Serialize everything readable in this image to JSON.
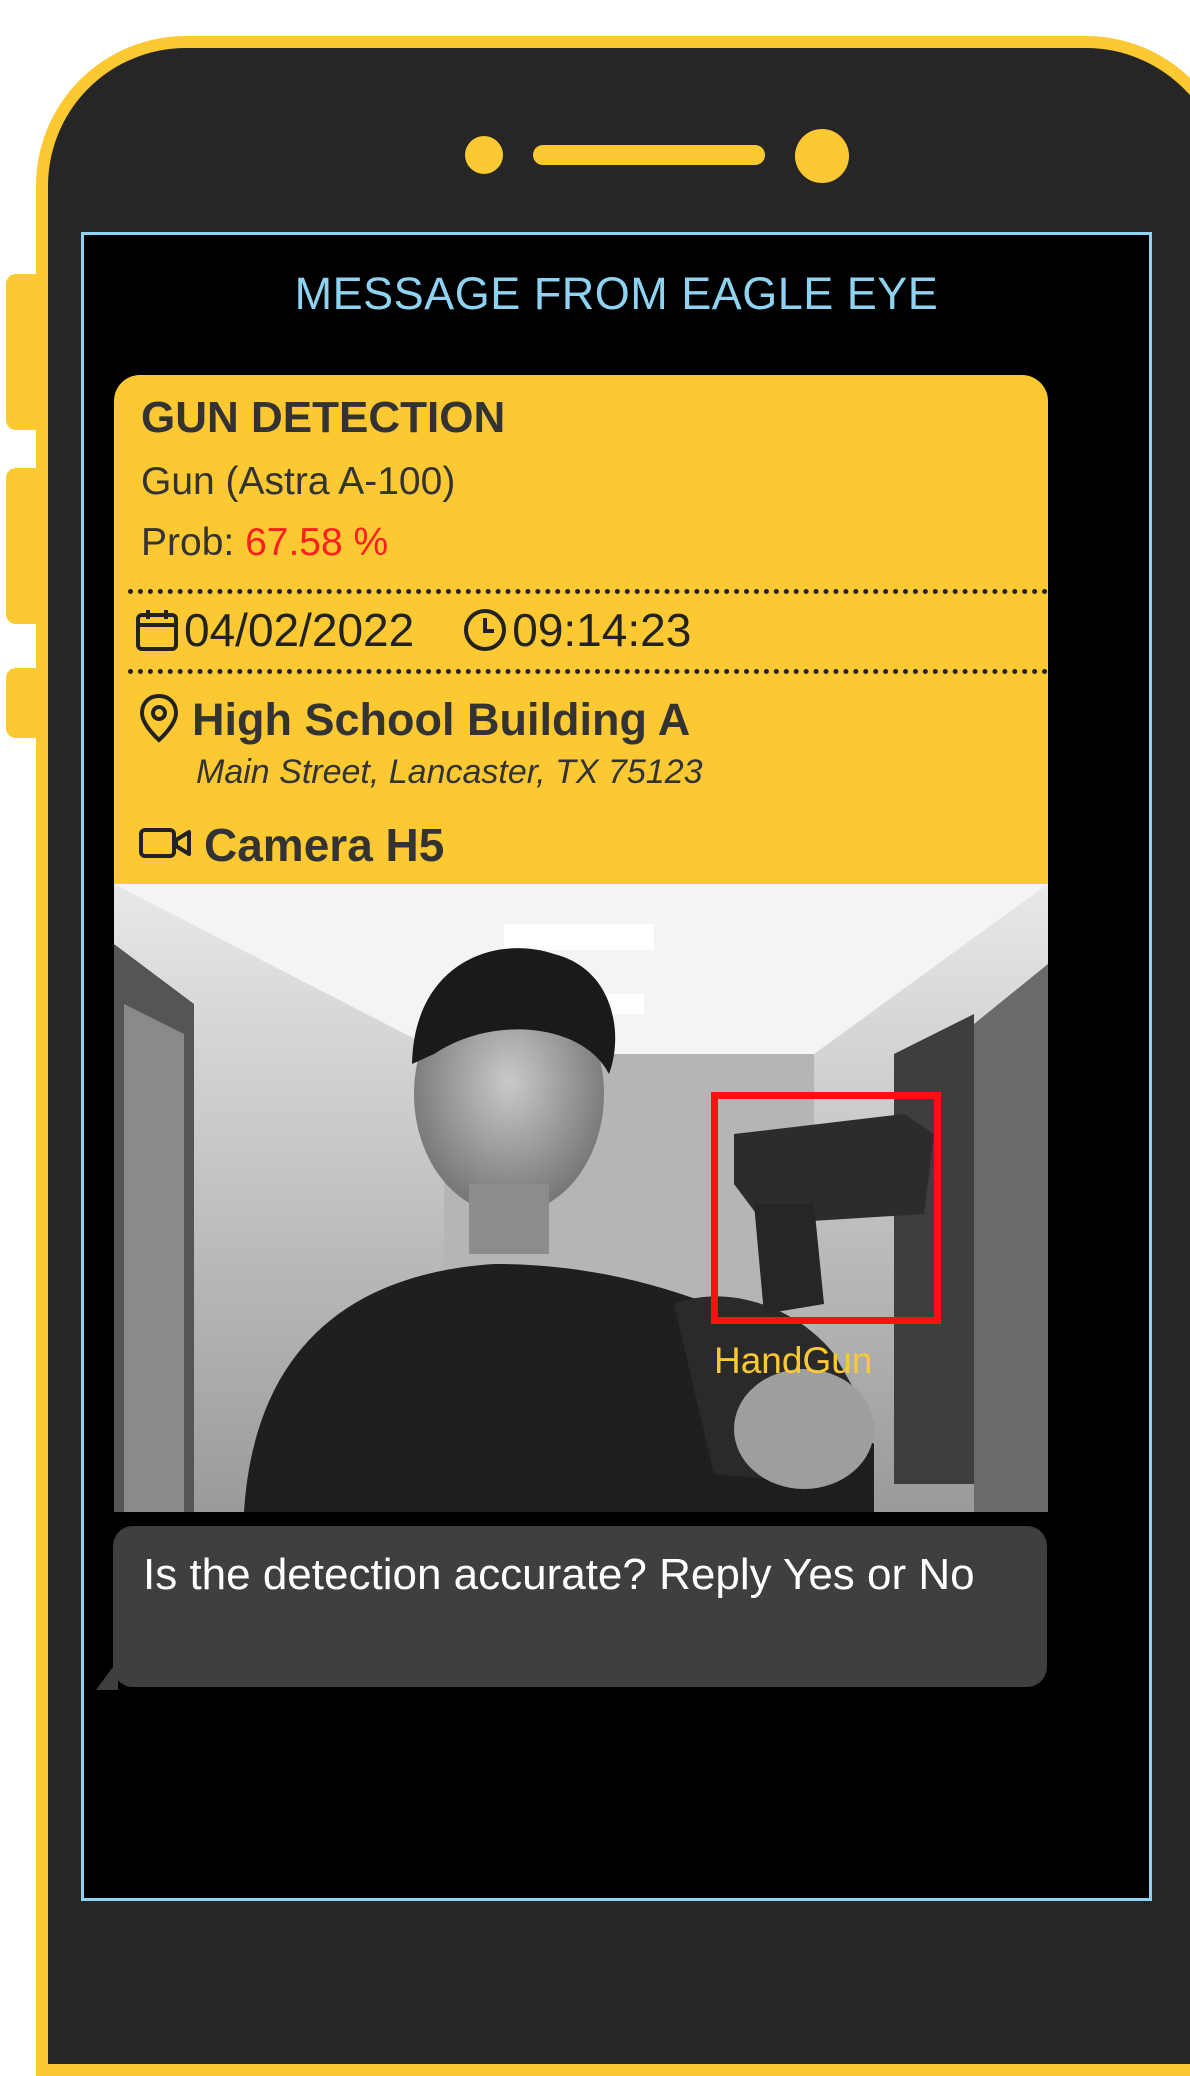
{
  "screen": {
    "title": "MESSAGE FROM EAGLE EYE"
  },
  "alert": {
    "title": "GUN DETECTION",
    "weapon_model": "Gun (Astra A-100)",
    "probability_label": "Prob: ",
    "probability_value": "67.58 %",
    "date": "04/02/2022",
    "time": "09:14:23",
    "location_name": "High School Building A",
    "location_address": "Main Street, Lancaster, TX 75123",
    "camera": "Camera H5"
  },
  "photo": {
    "detection_label": "HandGun"
  },
  "reply_prompt": {
    "text": "Is the detection accurate? Reply Yes or No"
  },
  "colors": {
    "accent_yellow": "#fcc933",
    "screen_border": "#8fd3f2",
    "probability": "#ff1f1f",
    "detection_box": "#ff1010",
    "bubble": "#3f3f3f"
  },
  "icons": [
    "calendar-icon",
    "clock-icon",
    "location-pin-icon",
    "video-camera-icon"
  ]
}
